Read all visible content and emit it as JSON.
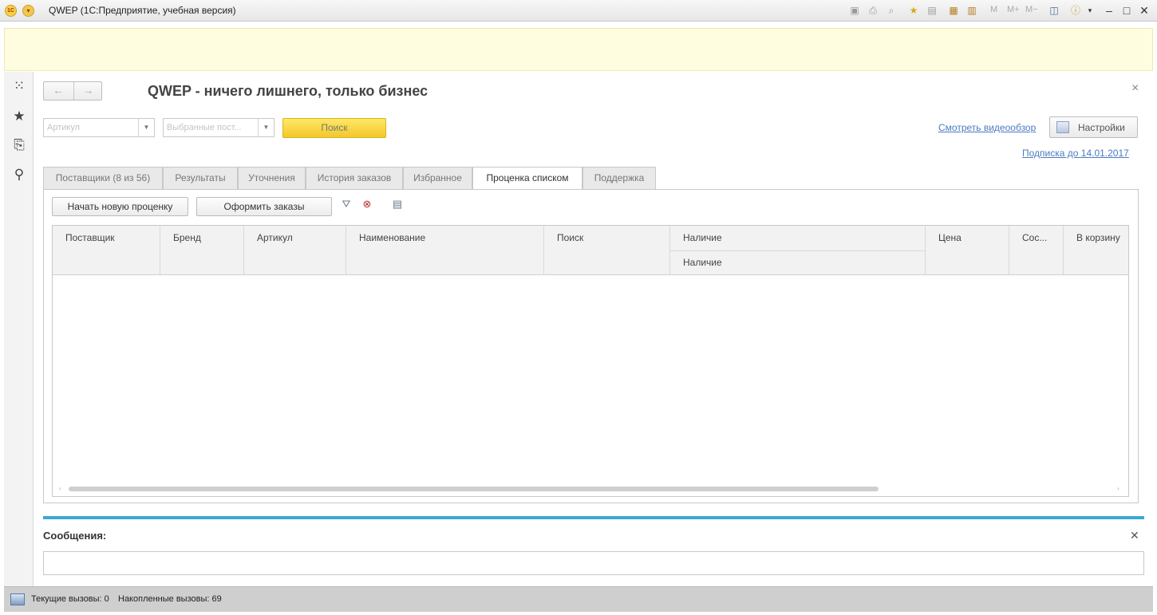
{
  "window": {
    "logo_text": "1С",
    "title": "QWEP  (1С:Предприятие, учебная версия)",
    "toolbar_text": [
      "M",
      "M+",
      "M−"
    ]
  },
  "leftpanel": {
    "icons": [
      "apps-grid-icon",
      "star-icon",
      "history-icon",
      "search-icon"
    ]
  },
  "form": {
    "title": "QWEP - ничего лишнего, только бизнес",
    "article_placeholder": "Артикул",
    "suppliers_placeholder": "Выбранные пост...",
    "search_button": "Поиск",
    "video_link": "Смотреть видеообзор",
    "settings_button": "Настройки",
    "subscription_link": "Подписка до 14.01.2017"
  },
  "tabs": [
    {
      "label": "Поставщики (8 из 56)"
    },
    {
      "label": "Результаты"
    },
    {
      "label": "Уточнения"
    },
    {
      "label": "История заказов"
    },
    {
      "label": "Избранное"
    },
    {
      "label": "Проценка  списком",
      "active": true
    },
    {
      "label": "Поддержка"
    }
  ],
  "commands": {
    "new_estimate": "Начать новую проценку",
    "place_orders": "Оформить заказы"
  },
  "table": {
    "columns": [
      "Поставщик",
      "Бренд",
      "Артикул",
      "Наименование",
      "Поиск",
      "Наличие",
      "Цена",
      "Сос...",
      "В корзину"
    ],
    "subheader": "Наличие",
    "rows": []
  },
  "messages": {
    "title": "Сообщения:"
  },
  "status": {
    "current_calls": "Текущие вызовы: 0",
    "accumulated_calls": "Накопленные вызовы: 69"
  },
  "colors": {
    "accent_yellow": "#f3c72b",
    "messages_bar": "#3aa8d6",
    "link": "#4b7bbf"
  }
}
